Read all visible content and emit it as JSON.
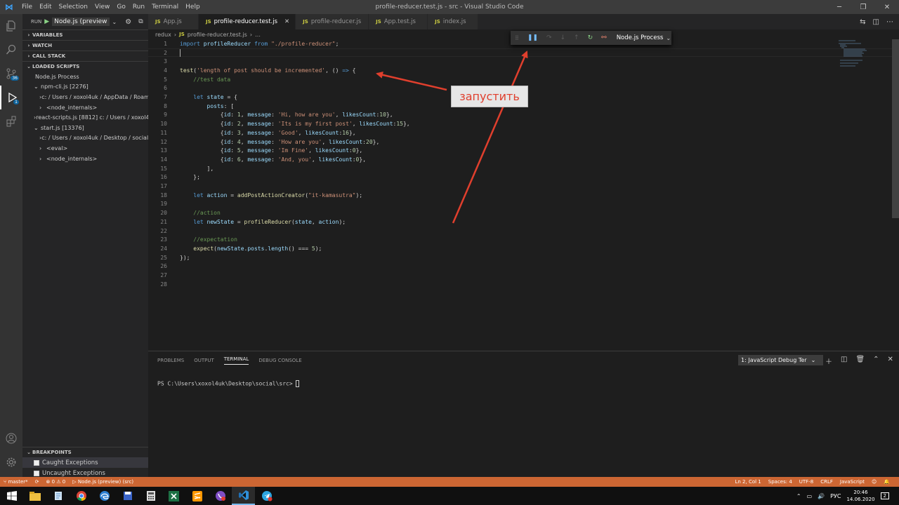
{
  "window": {
    "title": "profile-reducer.test.js - src - Visual Studio Code"
  },
  "menu": [
    "File",
    "Edit",
    "Selection",
    "View",
    "Go",
    "Run",
    "Terminal",
    "Help"
  ],
  "run": {
    "label": "RUN",
    "config": "Node.js (preview"
  },
  "sidebar": {
    "sections": {
      "variables": "VARIABLES",
      "watch": "WATCH",
      "call_stack": "CALL STACK",
      "loaded_scripts": "LOADED SCRIPTS",
      "breakpoints": "BREAKPOINTS"
    },
    "loaded": [
      {
        "label": "Node.js Process",
        "indent": 0,
        "chev": ""
      },
      {
        "label": "npm-cli.js [2276]",
        "indent": 1,
        "chev": "⌄"
      },
      {
        "label": "c: / Users / xoxol4uk / AppData / Roamin…",
        "indent": 2,
        "chev": "›"
      },
      {
        "label": "<node_internals>",
        "indent": 2,
        "chev": "›"
      },
      {
        "label": "react-scripts.js [8812] c: / Users / xoxol4…",
        "indent": 1,
        "chev": "›"
      },
      {
        "label": "start.js [13376]",
        "indent": 1,
        "chev": "⌄"
      },
      {
        "label": "c: / Users / xoxol4uk / Desktop / social",
        "indent": 2,
        "chev": "›"
      },
      {
        "label": "<eval>",
        "indent": 2,
        "chev": "›"
      },
      {
        "label": "<node_internals>",
        "indent": 2,
        "chev": "›"
      }
    ],
    "breakpoints": [
      "Caught Exceptions",
      "Uncaught Exceptions"
    ]
  },
  "activity": {
    "source_control_badge": "36",
    "debug_badge": "1"
  },
  "tabs": [
    {
      "label": "App.js",
      "active": false
    },
    {
      "label": "profile-reducer.test.js",
      "active": true
    },
    {
      "label": "profile-reducer.js",
      "active": false
    },
    {
      "label": "App.test.js",
      "active": false
    },
    {
      "label": "index.js",
      "active": false
    }
  ],
  "breadcrumb": {
    "folder": "redux",
    "file": "profile-reducer.test.js",
    "more": "…"
  },
  "code": [
    [
      [
        "kw",
        "import "
      ],
      [
        "var",
        "profileReducer "
      ],
      [
        "kw",
        "from "
      ],
      [
        "str",
        "\"./profile-reducer\""
      ],
      [
        "",
        "; "
      ]
    ],
    [],
    [],
    [
      [
        "fn",
        "test"
      ],
      [
        "",
        "("
      ],
      [
        "str",
        "'length of post should be incremented'"
      ],
      [
        "",
        ", () "
      ],
      [
        "kw",
        "=>"
      ],
      [
        "",
        " {"
      ]
    ],
    [
      [
        "cm",
        "    //test data"
      ]
    ],
    [],
    [
      [
        "kw",
        "    let "
      ],
      [
        "var",
        "state "
      ],
      [
        "",
        "= {"
      ]
    ],
    [
      [
        "var",
        "        posts"
      ],
      [
        "",
        ": ["
      ]
    ],
    [
      [
        "",
        "            {"
      ],
      [
        "var",
        "id"
      ],
      [
        "",
        ": "
      ],
      [
        "num",
        "1"
      ],
      [
        "",
        ", "
      ],
      [
        "var",
        "message"
      ],
      [
        "",
        ": "
      ],
      [
        "str",
        "'Hi, how are you'"
      ],
      [
        "",
        ", "
      ],
      [
        "var",
        "likesCount"
      ],
      [
        "",
        ":"
      ],
      [
        "num",
        "10"
      ],
      [
        "",
        "},"
      ]
    ],
    [
      [
        "",
        "            {"
      ],
      [
        "var",
        "id"
      ],
      [
        "",
        ": "
      ],
      [
        "num",
        "2"
      ],
      [
        "",
        ", "
      ],
      [
        "var",
        "message"
      ],
      [
        "",
        ": "
      ],
      [
        "str",
        "'Its is my first post'"
      ],
      [
        "",
        ", "
      ],
      [
        "var",
        "likesCount"
      ],
      [
        "",
        ":"
      ],
      [
        "num",
        "15"
      ],
      [
        "",
        "},"
      ]
    ],
    [
      [
        "",
        "            {"
      ],
      [
        "var",
        "id"
      ],
      [
        "",
        ": "
      ],
      [
        "num",
        "3"
      ],
      [
        "",
        ", "
      ],
      [
        "var",
        "message"
      ],
      [
        "",
        ": "
      ],
      [
        "str",
        "'Good'"
      ],
      [
        "",
        ", "
      ],
      [
        "var",
        "likesCount"
      ],
      [
        "",
        ":"
      ],
      [
        "num",
        "16"
      ],
      [
        "",
        "},"
      ]
    ],
    [
      [
        "",
        "            {"
      ],
      [
        "var",
        "id"
      ],
      [
        "",
        ": "
      ],
      [
        "num",
        "4"
      ],
      [
        "",
        ", "
      ],
      [
        "var",
        "message"
      ],
      [
        "",
        ": "
      ],
      [
        "str",
        "'How are you'"
      ],
      [
        "",
        ", "
      ],
      [
        "var",
        "likesCount"
      ],
      [
        "",
        ":"
      ],
      [
        "num",
        "20"
      ],
      [
        "",
        "},"
      ]
    ],
    [
      [
        "",
        "            {"
      ],
      [
        "var",
        "id"
      ],
      [
        "",
        ": "
      ],
      [
        "num",
        "5"
      ],
      [
        "",
        ", "
      ],
      [
        "var",
        "message"
      ],
      [
        "",
        ": "
      ],
      [
        "str",
        "'Im Fine'"
      ],
      [
        "",
        ", "
      ],
      [
        "var",
        "likesCount"
      ],
      [
        "",
        ":"
      ],
      [
        "num",
        "0"
      ],
      [
        "",
        "},"
      ]
    ],
    [
      [
        "",
        "            {"
      ],
      [
        "var",
        "id"
      ],
      [
        "",
        ": "
      ],
      [
        "num",
        "6"
      ],
      [
        "",
        ", "
      ],
      [
        "var",
        "message"
      ],
      [
        "",
        ": "
      ],
      [
        "str",
        "'And, you'"
      ],
      [
        "",
        ", "
      ],
      [
        "var",
        "likesCount"
      ],
      [
        "",
        ":"
      ],
      [
        "num",
        "0"
      ],
      [
        "",
        "},"
      ]
    ],
    [
      [
        "",
        "        ],"
      ]
    ],
    [
      [
        "",
        "    };"
      ]
    ],
    [],
    [
      [
        "kw",
        "    let "
      ],
      [
        "var",
        "action "
      ],
      [
        "",
        "= "
      ],
      [
        "fn",
        "addPostActionCreator"
      ],
      [
        "",
        "("
      ],
      [
        "str",
        "\"it-kamasutra\""
      ],
      [
        "",
        ");"
      ]
    ],
    [],
    [
      [
        "cm",
        "    //action"
      ]
    ],
    [
      [
        "kw",
        "    let "
      ],
      [
        "var",
        "newState "
      ],
      [
        "",
        "= "
      ],
      [
        "fn",
        "profileReducer"
      ],
      [
        "",
        "("
      ],
      [
        "var",
        "state"
      ],
      [
        "",
        ", "
      ],
      [
        "var",
        "action"
      ],
      [
        "",
        ");"
      ]
    ],
    [],
    [
      [
        "cm",
        "    //expectation"
      ]
    ],
    [
      [
        "fn",
        "    expect"
      ],
      [
        "",
        "("
      ],
      [
        "var",
        "newState"
      ],
      [
        "",
        "."
      ],
      [
        "var",
        "posts"
      ],
      [
        "",
        "."
      ],
      [
        "var",
        "length"
      ],
      [
        "",
        "() === "
      ],
      [
        "num",
        "5"
      ],
      [
        "",
        ");"
      ]
    ],
    [
      [
        "",
        "});"
      ]
    ],
    [],
    [],
    []
  ],
  "debug_toolbar": {
    "process": "Node.js Process"
  },
  "callout": {
    "text": "запустить"
  },
  "panel": {
    "tabs": [
      "PROBLEMS",
      "OUTPUT",
      "TERMINAL",
      "DEBUG CONSOLE"
    ],
    "active_tab": "TERMINAL",
    "terminal_select": "1: JavaScript Debug Ter",
    "prompt": "PS C:\\Users\\xoxol4uk\\Desktop\\social\\src> "
  },
  "statusbar": {
    "branch": "master*",
    "errors": "0",
    "warnings": "0",
    "debug": "Node.js (preview) (src)",
    "position": "Ln 2, Col 1",
    "spaces": "Spaces: 4",
    "encoding": "UTF-8",
    "eol": "CRLF",
    "language": "JavaScript"
  },
  "taskbar": {
    "lang": "РУС",
    "time": "20:46",
    "date": "14.06.2020",
    "notif": "2"
  },
  "colors": {
    "statusbar": "#cc6633",
    "accent": "#0e639c",
    "arrow": "#e03f2d"
  }
}
